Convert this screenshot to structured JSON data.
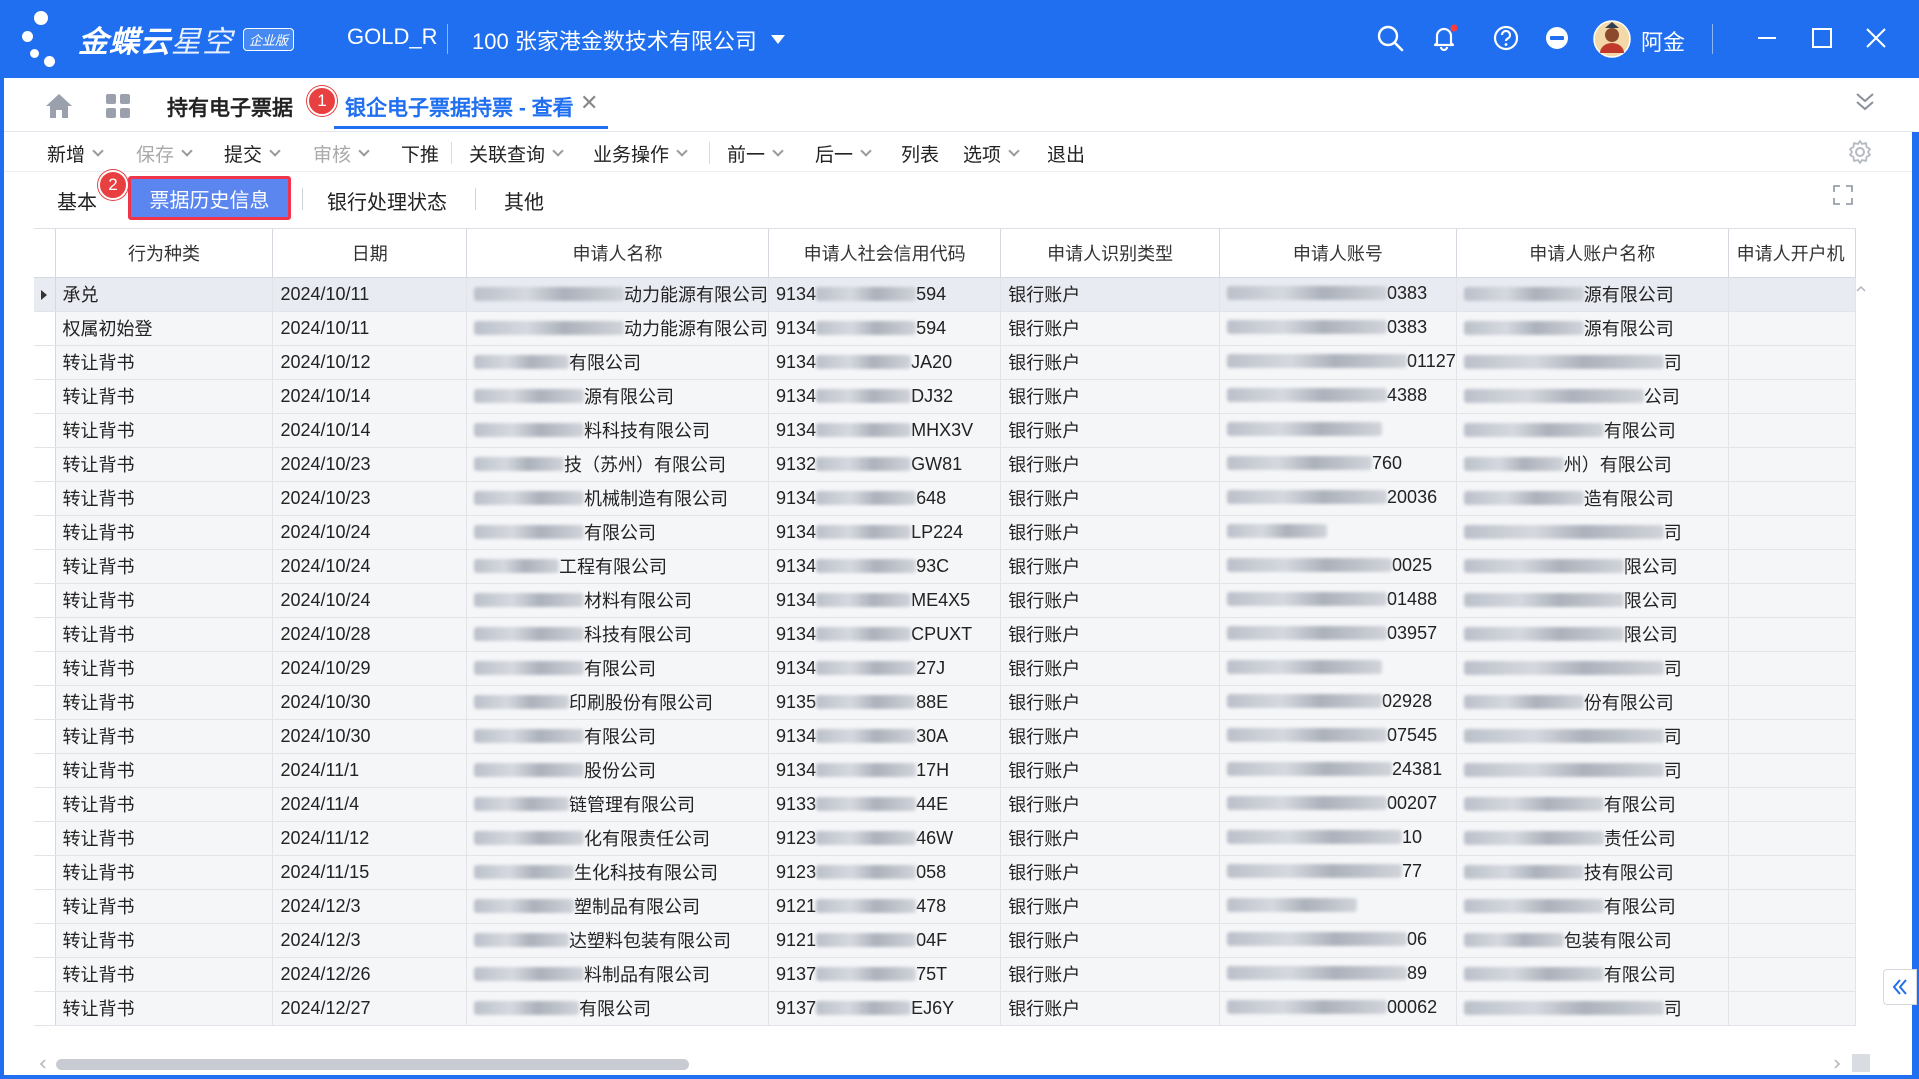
{
  "titlebar": {
    "logo_main": "金蝶云",
    "logo_sub": "星空",
    "edition": "企业版",
    "user_code": "GOLD_R",
    "org": "100  张家港金数技术有限公司",
    "user_name": "阿金",
    "icons": [
      "search-icon",
      "bell-icon",
      "help-icon",
      "minus-circle-icon",
      "avatar",
      "window-minimize-icon",
      "window-maximize-icon",
      "window-close-icon"
    ]
  },
  "tabs": {
    "tab1": "持有电子票据",
    "badge1": "1",
    "tab2": "银企电子票据持票 - 查看",
    "close": "✕"
  },
  "toolbar": {
    "items": [
      {
        "label": "新增",
        "dropdown": true,
        "disabled": false
      },
      {
        "label": "保存",
        "dropdown": true,
        "disabled": true
      },
      {
        "label": "提交",
        "dropdown": true,
        "disabled": false
      },
      {
        "label": "审核",
        "dropdown": true,
        "disabled": true
      },
      {
        "label": "下推",
        "dropdown": false,
        "disabled": false
      },
      {
        "label": "关联查询",
        "dropdown": true,
        "disabled": false
      },
      {
        "label": "业务操作",
        "dropdown": true,
        "disabled": false
      },
      {
        "label": "前一",
        "dropdown": true,
        "disabled": false
      },
      {
        "label": "后一",
        "dropdown": true,
        "disabled": false
      },
      {
        "label": "列表",
        "dropdown": false,
        "disabled": false
      },
      {
        "label": "选项",
        "dropdown": true,
        "disabled": false
      },
      {
        "label": "退出",
        "dropdown": false,
        "disabled": false
      }
    ]
  },
  "subtabs": {
    "basic": "基本",
    "badge2": "2",
    "history": "票据历史信息",
    "bank_status": "银行处理状态",
    "other": "其他"
  },
  "table": {
    "columns": [
      "行为种类",
      "日期",
      "申请人名称",
      "申请人社会信用代码",
      "申请人识别类型",
      "申请人账号",
      "申请人账户名称",
      "申请人开户机"
    ],
    "rows": [
      {
        "type": "承兑",
        "date": "2024/10/11",
        "name": "动力能源有限公司",
        "code_pre": "9134",
        "code_suf": "594",
        "idtype": "银行账户",
        "acct": "0383",
        "acctname": "源有限公司"
      },
      {
        "type": "权属初始登",
        "date": "2024/10/11",
        "name": "动力能源有限公司",
        "code_pre": "9134",
        "code_suf": "594",
        "idtype": "银行账户",
        "acct": "0383",
        "acctname": "源有限公司"
      },
      {
        "type": "转让背书",
        "date": "2024/10/12",
        "name": "有限公司",
        "code_pre": "9134",
        "code_suf": "JA20",
        "idtype": "银行账户",
        "acct": "01127",
        "acctname": "司"
      },
      {
        "type": "转让背书",
        "date": "2024/10/14",
        "name": "源有限公司",
        "code_pre": "9134",
        "code_suf": "DJ32",
        "idtype": "银行账户",
        "acct": "4388",
        "acctname": "公司"
      },
      {
        "type": "转让背书",
        "date": "2024/10/14",
        "name": "料科技有限公司",
        "code_pre": "9134",
        "code_suf": "MHX3V",
        "idtype": "银行账户",
        "acct": "",
        "acctname": "有限公司"
      },
      {
        "type": "转让背书",
        "date": "2024/10/23",
        "name": "技（苏州）有限公司",
        "code_pre": "9132",
        "code_suf": "GW81",
        "idtype": "银行账户",
        "acct": "760",
        "acctname": "州）有限公司"
      },
      {
        "type": "转让背书",
        "date": "2024/10/23",
        "name": "机械制造有限公司",
        "code_pre": "9134",
        "code_suf": "648",
        "idtype": "银行账户",
        "acct": "20036",
        "acctname": "造有限公司"
      },
      {
        "type": "转让背书",
        "date": "2024/10/24",
        "name": "有限公司",
        "code_pre": "9134",
        "code_suf": "LP224",
        "idtype": "银行账户",
        "acct": "",
        "acctname": "司"
      },
      {
        "type": "转让背书",
        "date": "2024/10/24",
        "name": "工程有限公司",
        "code_pre": "9134",
        "code_suf": "93C",
        "idtype": "银行账户",
        "acct": "0025",
        "acctname": "限公司"
      },
      {
        "type": "转让背书",
        "date": "2024/10/24",
        "name": "材料有限公司",
        "code_pre": "9134",
        "code_suf": "ME4X5",
        "idtype": "银行账户",
        "acct": "01488",
        "acctname": "限公司"
      },
      {
        "type": "转让背书",
        "date": "2024/10/28",
        "name": "科技有限公司",
        "code_pre": "9134",
        "code_suf": "CPUXT",
        "idtype": "银行账户",
        "acct": "03957",
        "acctname": "限公司"
      },
      {
        "type": "转让背书",
        "date": "2024/10/29",
        "name": "有限公司",
        "code_pre": "9134",
        "code_suf": "27J",
        "idtype": "银行账户",
        "acct": "",
        "acctname": "司"
      },
      {
        "type": "转让背书",
        "date": "2024/10/30",
        "name": "印刷股份有限公司",
        "code_pre": "9135",
        "code_suf": "88E",
        "idtype": "银行账户",
        "acct": "02928",
        "acctname": "份有限公司"
      },
      {
        "type": "转让背书",
        "date": "2024/10/30",
        "name": "有限公司",
        "code_pre": "9134",
        "code_suf": "30A",
        "idtype": "银行账户",
        "acct": "07545",
        "acctname": "司"
      },
      {
        "type": "转让背书",
        "date": "2024/11/1",
        "name": "股份公司",
        "code_pre": "9134",
        "code_suf": "17H",
        "idtype": "银行账户",
        "acct": "24381",
        "acctname": "司"
      },
      {
        "type": "转让背书",
        "date": "2024/11/4",
        "name": "链管理有限公司",
        "code_pre": "9133",
        "code_suf": "44E",
        "idtype": "银行账户",
        "acct": "00207",
        "acctname": "有限公司"
      },
      {
        "type": "转让背书",
        "date": "2024/11/12",
        "name": "化有限责任公司",
        "code_pre": "9123",
        "code_suf": "46W",
        "idtype": "银行账户",
        "acct": "10",
        "acctname": "责任公司"
      },
      {
        "type": "转让背书",
        "date": "2024/11/15",
        "name": "生化科技有限公司",
        "code_pre": "9123",
        "code_suf": "058",
        "idtype": "银行账户",
        "acct": "77",
        "acctname": "技有限公司"
      },
      {
        "type": "转让背书",
        "date": "2024/12/3",
        "name": "塑制品有限公司",
        "code_pre": "9121",
        "code_suf": "478",
        "idtype": "银行账户",
        "acct": "",
        "acctname": "有限公司"
      },
      {
        "type": "转让背书",
        "date": "2024/12/3",
        "name": "达塑料包装有限公司",
        "code_pre": "9121",
        "code_suf": "04F",
        "idtype": "银行账户",
        "acct": "06",
        "acctname": "包装有限公司"
      },
      {
        "type": "转让背书",
        "date": "2024/12/26",
        "name": "料制品有限公司",
        "code_pre": "9137",
        "code_suf": "75T",
        "idtype": "银行账户",
        "acct": "89",
        "acctname": "有限公司"
      },
      {
        "type": "转让背书",
        "date": "2024/12/27",
        "name": "有限公司",
        "code_pre": "9137",
        "code_suf": "EJ6Y",
        "idtype": "银行账户",
        "acct": "00062",
        "acctname": "司"
      }
    ]
  }
}
